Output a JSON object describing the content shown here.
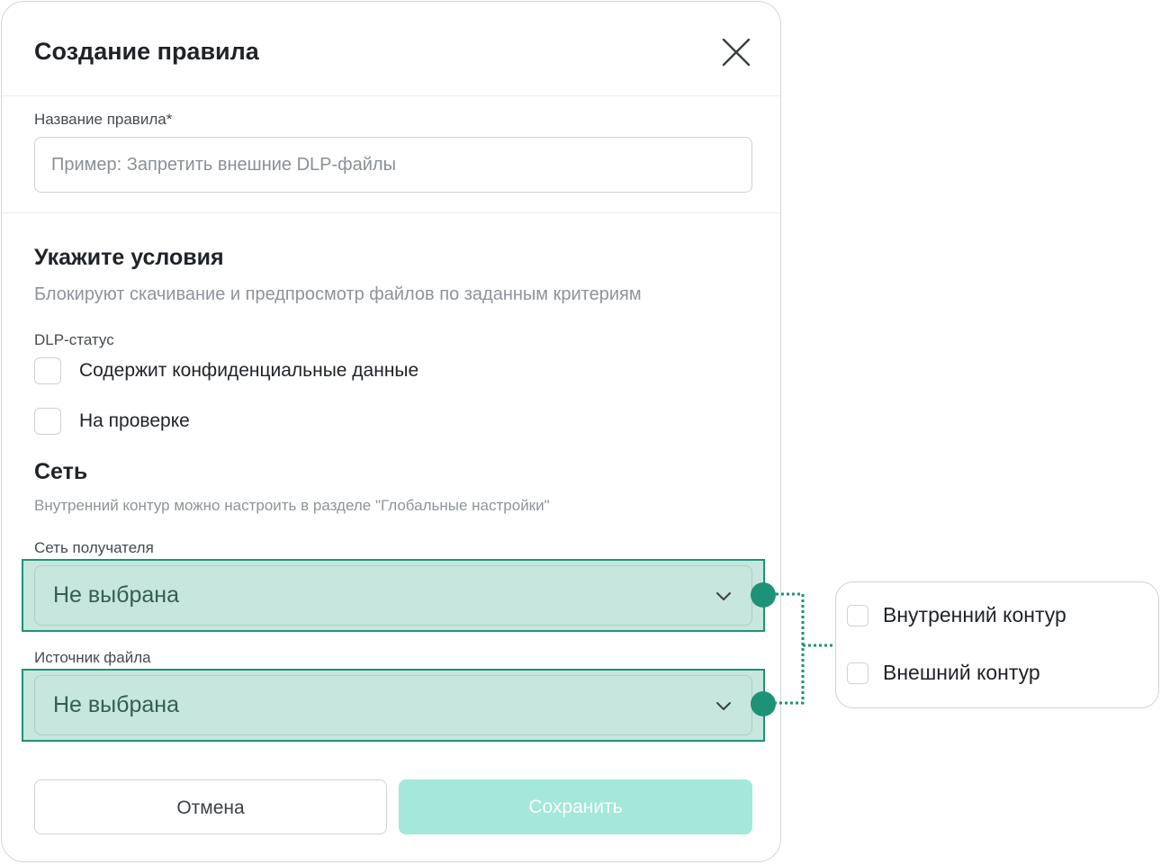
{
  "modal": {
    "title": "Создание правила",
    "icons": {
      "close": "close-icon",
      "chevron": "chevron-down-icon"
    }
  },
  "rule_name": {
    "label": "Название правила*",
    "value": "",
    "placeholder": "Пример: Запретить внешние DLP-файлы"
  },
  "conditions": {
    "title": "Укажите условия",
    "subtitle": "Блокируют скачивание и предпросмотр файлов по заданным критериям"
  },
  "dlp": {
    "label": "DLP-статус",
    "options": [
      {
        "label": "Содержит конфиденциальные данные",
        "checked": false
      },
      {
        "label": "На проверке",
        "checked": false
      }
    ]
  },
  "network": {
    "title": "Сеть",
    "hint": "Внутренний контур можно настроить в разделе \"Глобальные настройки\"",
    "recipient": {
      "label": "Сеть получателя",
      "value": "Не выбрана"
    },
    "source": {
      "label": "Источник файла",
      "value": "Не выбрана"
    }
  },
  "actions": {
    "cancel": "Отмена",
    "save": "Сохранить"
  },
  "dropdown": {
    "options": [
      {
        "label": "Внутренний контур",
        "checked": false
      },
      {
        "label": "Внешний контур",
        "checked": false
      }
    ]
  },
  "colors": {
    "accent": "#1e9276",
    "highlight_fill": "#c7e6dd",
    "save_disabled": "#a3e8d8"
  }
}
